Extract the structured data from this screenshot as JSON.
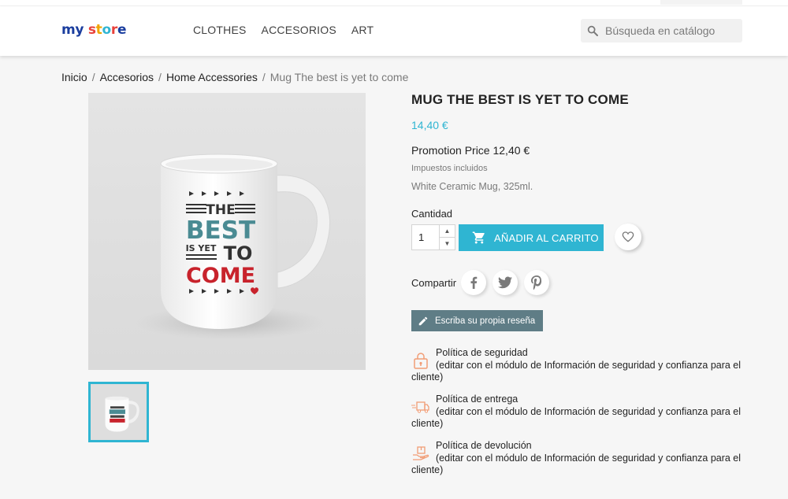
{
  "header": {
    "logo": {
      "my": "my",
      "store": "store"
    },
    "nav": [
      "CLOTHES",
      "ACCESORIOS",
      "ART"
    ],
    "search_placeholder": "Búsqueda en catálogo"
  },
  "breadcrumb": [
    "Inicio",
    "Accesorios",
    "Home Accessories",
    "Mug The best is yet to come"
  ],
  "product": {
    "title": "MUG THE BEST IS YET TO COME",
    "price": "14,40 €",
    "promotion": "Promotion Price 12,40 €",
    "taxes": "Impuestos incluidos",
    "description": "White Ceramic Mug, 325ml.",
    "quantity_label": "Cantidad",
    "quantity": "1",
    "add_to_cart": "AÑADIR AL CARRITO",
    "share_label": "Compartir",
    "review_button": "Escriba su propia reseña",
    "mug_text": {
      "the": "THE",
      "best": "BEST",
      "is_yet": "IS YET",
      "to": "TO",
      "come": "COME"
    }
  },
  "reassurance": [
    {
      "title": "Política de seguridad",
      "text": "(editar con el módulo de Información de seguridad y confianza para el cliente)",
      "icon": "lock-icon"
    },
    {
      "title": "Política de entrega",
      "text": "(editar con el módulo de Información de seguridad y confianza para el cliente)",
      "icon": "delivery-truck-icon"
    },
    {
      "title": "Política de devolución",
      "text": "(editar con el módulo de Información de seguridad y confianza para el cliente)",
      "icon": "return-hand-icon"
    }
  ],
  "colors": {
    "accent": "#2fb5d2",
    "review_button": "#5f7d86",
    "mug_teal": "#4a8b93",
    "mug_red": "#c8232c"
  }
}
